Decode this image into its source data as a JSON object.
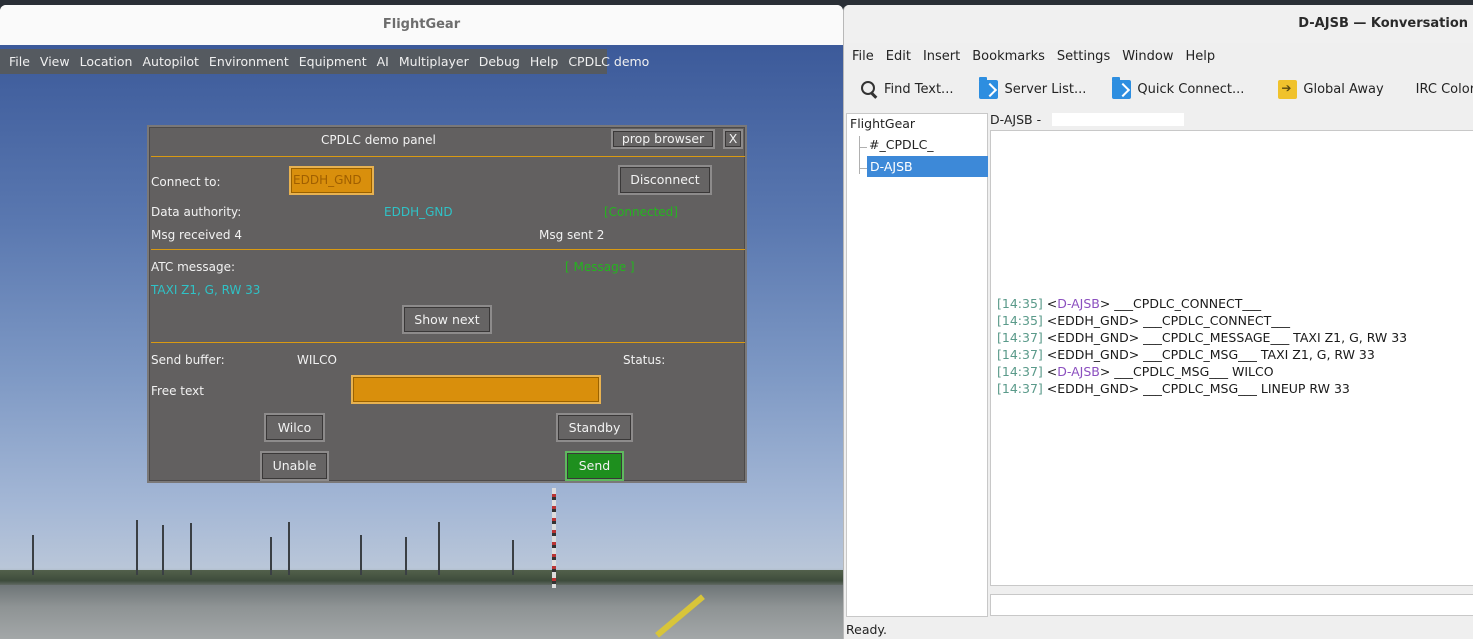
{
  "flightgear": {
    "title": "FlightGear",
    "menu": [
      "File",
      "View",
      "Location",
      "Autopilot",
      "Environment",
      "Equipment",
      "AI",
      "Multiplayer",
      "Debug",
      "Help",
      "CPDLC demo"
    ],
    "panel": {
      "title": "CPDLC demo panel",
      "prop_browser": "prop browser",
      "close": "X",
      "connect_label": "Connect to:",
      "connect_value": "EDDH_GND",
      "disconnect": "Disconnect",
      "data_authority_label": "Data authority:",
      "data_authority_value": "EDDH_GND",
      "connection_status": "[Connected]",
      "msg_received": "Msg received 4",
      "msg_sent": "Msg sent 2",
      "atc_message_label": "ATC message:",
      "message_indicator": "[ Message ]",
      "atc_message_text": "TAXI Z1, G, RW 33",
      "show_next": "Show next",
      "send_buffer_label": "Send buffer:",
      "send_buffer_value": "WILCO",
      "status_label": "Status:",
      "free_text_label": "Free text",
      "free_text_value": "",
      "wilco": "Wilco",
      "standby": "Standby",
      "unable": "Unable",
      "send": "Send"
    }
  },
  "konversation": {
    "title": "D-AJSB — Konversation",
    "menu": [
      "File",
      "Edit",
      "Insert",
      "Bookmarks",
      "Settings",
      "Window",
      "Help"
    ],
    "toolbar": {
      "find_text": "Find Text...",
      "server_list": "Server List...",
      "quick_connect": "Quick Connect...",
      "global_away": "Global Away",
      "irc_color": "IRC Color..."
    },
    "tree": {
      "server": "FlightGear",
      "channel": "#_CPDLC_",
      "query": "D-AJSB"
    },
    "topic": "D-AJSB -",
    "chat": [
      {
        "time": "[14:35]",
        "nick": "D-AJSB",
        "self": true,
        "text": "___CPDLC_CONNECT___"
      },
      {
        "time": "[14:35]",
        "nick": "EDDH_GND",
        "self": false,
        "text": "___CPDLC_CONNECT___"
      },
      {
        "time": "[14:37]",
        "nick": "EDDH_GND",
        "self": false,
        "text": "___CPDLC_MESSAGE___ TAXI Z1, G, RW 33"
      },
      {
        "time": "[14:37]",
        "nick": "EDDH_GND",
        "self": false,
        "text": "___CPDLC_MSG___ TAXI Z1, G, RW 33"
      },
      {
        "time": "[14:37]",
        "nick": "D-AJSB",
        "self": true,
        "text": "___CPDLC_MSG___ WILCO"
      },
      {
        "time": "[14:37]",
        "nick": "EDDH_GND",
        "self": false,
        "text": "___CPDLC_MSG___ LINEUP RW 33"
      }
    ],
    "status": "Ready."
  }
}
